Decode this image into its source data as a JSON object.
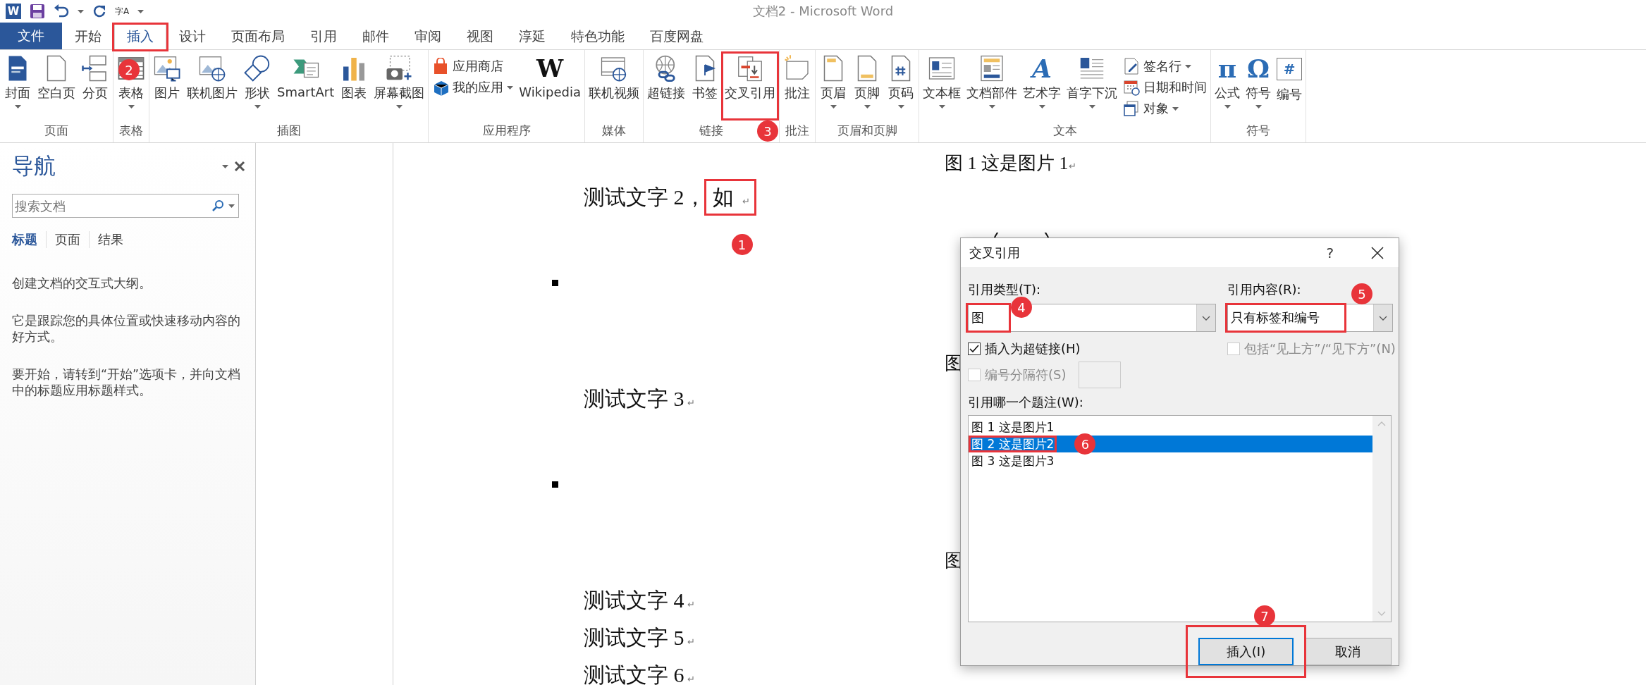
{
  "window": {
    "title": "文档2 - Microsoft Word"
  },
  "quick_access": {
    "logo": "W",
    "spelling": "字A"
  },
  "file_tab": "文件",
  "tabs": [
    {
      "label": "开始",
      "selected": false,
      "marked": false
    },
    {
      "label": "插入",
      "selected": true,
      "marked": true,
      "badge": "2"
    },
    {
      "label": "设计",
      "selected": false,
      "marked": false
    },
    {
      "label": "页面布局",
      "selected": false,
      "marked": false
    },
    {
      "label": "引用",
      "selected": false,
      "marked": false
    },
    {
      "label": "邮件",
      "selected": false,
      "marked": false
    },
    {
      "label": "审阅",
      "selected": false,
      "marked": false
    },
    {
      "label": "视图",
      "selected": false,
      "marked": false
    },
    {
      "label": "淳延",
      "selected": false,
      "marked": false
    },
    {
      "label": "特色功能",
      "selected": false,
      "marked": false
    },
    {
      "label": "百度网盘",
      "selected": false,
      "marked": false
    }
  ],
  "ribbon": {
    "groups": [
      {
        "label": "页面",
        "items": [
          {
            "kind": "large",
            "label": "封面",
            "dropdown": true
          },
          {
            "kind": "large",
            "label": "空白页",
            "dropdown": false
          },
          {
            "kind": "large",
            "label": "分页",
            "dropdown": false
          }
        ]
      },
      {
        "label": "表格",
        "items": [
          {
            "kind": "large",
            "label": "表格",
            "dropdown": true
          }
        ]
      },
      {
        "label": "插图",
        "items": [
          {
            "kind": "large",
            "label": "图片",
            "dropdown": false
          },
          {
            "kind": "large",
            "label": "联机图片",
            "dropdown": false
          },
          {
            "kind": "large",
            "label": "形状",
            "dropdown": true
          },
          {
            "kind": "large",
            "label": "SmartArt",
            "dropdown": false
          },
          {
            "kind": "large",
            "label": "图表",
            "dropdown": false
          },
          {
            "kind": "large",
            "label": "屏幕截图",
            "dropdown": true
          }
        ]
      },
      {
        "label": "应用程序",
        "items": [
          {
            "kind": "small",
            "label": "应用商店",
            "dropdown": false
          },
          {
            "kind": "small",
            "label": "我的应用",
            "dropdown": true
          },
          {
            "kind": "large",
            "label": "Wikipedia",
            "dropdown": false,
            "glyph": "W"
          }
        ]
      },
      {
        "label": "媒体",
        "items": [
          {
            "kind": "large",
            "label": "联机视频",
            "dropdown": false
          }
        ]
      },
      {
        "label": "链接",
        "items": [
          {
            "kind": "large",
            "label": "超链接",
            "dropdown": false
          },
          {
            "kind": "large",
            "label": "书签",
            "dropdown": false
          },
          {
            "kind": "large",
            "label": "交叉引用",
            "dropdown": false,
            "marked": true,
            "badge": "3"
          }
        ]
      },
      {
        "label": "批注",
        "items": [
          {
            "kind": "large",
            "label": "批注",
            "dropdown": false
          }
        ]
      },
      {
        "label": "页眉和页脚",
        "items": [
          {
            "kind": "large",
            "label": "页眉",
            "dropdown": true
          },
          {
            "kind": "large",
            "label": "页脚",
            "dropdown": true
          },
          {
            "kind": "large",
            "label": "页码",
            "dropdown": true
          }
        ]
      },
      {
        "label": "文本",
        "items": [
          {
            "kind": "large",
            "label": "文本框",
            "dropdown": true
          },
          {
            "kind": "large",
            "label": "文档部件",
            "dropdown": true
          },
          {
            "kind": "large",
            "label": "艺术字",
            "dropdown": true,
            "glyph": "A"
          },
          {
            "kind": "large",
            "label": "首字下沉",
            "dropdown": true
          },
          {
            "kind": "small",
            "label": "签名行",
            "dropdown": true
          },
          {
            "kind": "small",
            "label": "日期和时间",
            "dropdown": false
          },
          {
            "kind": "small",
            "label": "对象",
            "dropdown": true
          }
        ]
      },
      {
        "label": "符号",
        "items": [
          {
            "kind": "large",
            "label": "公式",
            "dropdown": true,
            "glyph": "π"
          },
          {
            "kind": "large",
            "label": "符号",
            "dropdown": true,
            "glyph": "Ω"
          },
          {
            "kind": "large",
            "label": "编号",
            "dropdown": false,
            "glyph": "#"
          }
        ]
      }
    ]
  },
  "nav": {
    "title": "导航",
    "search": {
      "placeholder": "搜索文档"
    },
    "tabs": [
      {
        "label": "标题",
        "selected": true
      },
      {
        "label": "页面",
        "selected": false
      },
      {
        "label": "结果",
        "selected": false
      }
    ],
    "paragraphs": [
      "创建文档的交互式大纲。",
      "它是跟踪您的具体位置或快速移动内容的好方式。",
      "要开始，请转到“开始”选项卡，并向文档中的标题应用标题样式。"
    ]
  },
  "document": {
    "body": [
      {
        "kind": "para",
        "parts": [
          {
            "text": "测试文字 2，",
            "marked": false
          },
          {
            "text": "如",
            "marked": true,
            "badge": "1"
          }
        ],
        "mark": "↵"
      },
      {
        "kind": "bullet"
      },
      {
        "kind": "para",
        "parts": [
          {
            "text": "测试文字 3",
            "marked": false
          }
        ],
        "mark": "↵"
      },
      {
        "kind": "bullet"
      },
      {
        "kind": "para",
        "parts": [
          {
            "text": "测试文字 4",
            "marked": false
          }
        ],
        "mark": "↵"
      },
      {
        "kind": "para",
        "parts": [
          {
            "text": "测试文字 5",
            "marked": false
          }
        ],
        "mark": "↵"
      },
      {
        "kind": "para",
        "parts": [
          {
            "text": "测试文字 6",
            "marked": false
          }
        ],
        "mark": "↵"
      }
    ],
    "captions": [
      {
        "text": "图 1 这是图片 1",
        "mark": "↵"
      },
      {
        "text": "图"
      },
      {
        "text": "图"
      }
    ]
  },
  "dialog": {
    "title": "交叉引用",
    "help": "?",
    "type_label": "引用类型(T):",
    "type_value": {
      "text": "图",
      "marked": true,
      "badge": "4"
    },
    "content_label": "引用内容(R):",
    "content_value": {
      "text": "只有标签和编号",
      "marked": true,
      "badge": "5"
    },
    "hyperlink_option": {
      "label": "插入为超链接(H)",
      "checked": true,
      "disabled": false
    },
    "above_below_option": {
      "label": "包括“见上方”/“见下方”(N)",
      "checked": false,
      "disabled": true
    },
    "separator_option": {
      "label": "编号分隔符(S)",
      "checked": false,
      "disabled": true
    },
    "captions_label": "引用哪一个题注(W):",
    "captions": [
      {
        "text": "图 1 这是图片1",
        "selected": false,
        "marked": false
      },
      {
        "text": "图 2 这是图片2",
        "selected": true,
        "marked": true,
        "badge": "6"
      },
      {
        "text": "图 3 这是图片3",
        "selected": false,
        "marked": false
      }
    ],
    "buttons": [
      {
        "label": "插入(I)",
        "default": true,
        "marked": true,
        "badge": "7"
      },
      {
        "label": "取消",
        "default": false,
        "marked": false
      }
    ]
  }
}
